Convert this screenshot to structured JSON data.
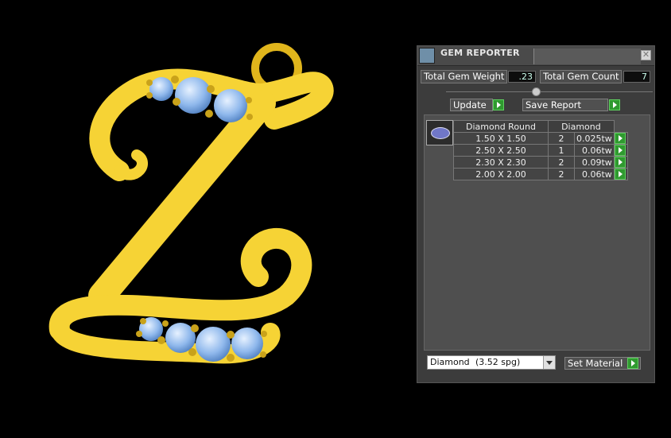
{
  "window": {
    "title": "GEM REPORTER",
    "close_icon": "close-icon"
  },
  "stats": {
    "total_gem_weight_label": "Total Gem Weight",
    "total_gem_weight_value": ".23",
    "total_gem_count_label": "Total Gem Count",
    "total_gem_count_value": "7"
  },
  "buttons": {
    "update": "Update",
    "save_report": "Save Report",
    "set_material": "Set Material"
  },
  "gem_table": {
    "headers": [
      "Diamond Round",
      "Diamond"
    ],
    "rows": [
      {
        "size": "1.50 X 1.50",
        "count": "2",
        "weight": "0.025tw"
      },
      {
        "size": "2.50 X 2.50",
        "count": "1",
        "weight": "0.06tw"
      },
      {
        "size": "2.30 X 2.30",
        "count": "2",
        "weight": "0.09tw"
      },
      {
        "size": "2.00 X 2.00",
        "count": "2",
        "weight": "0.06tw"
      }
    ]
  },
  "material": {
    "name": "Diamond",
    "spg": "(3.52 spg)"
  },
  "colors": {
    "gold": "#f6d335",
    "gem_blue": "#8fb8ec",
    "accent_green": "#2f9a2f"
  }
}
